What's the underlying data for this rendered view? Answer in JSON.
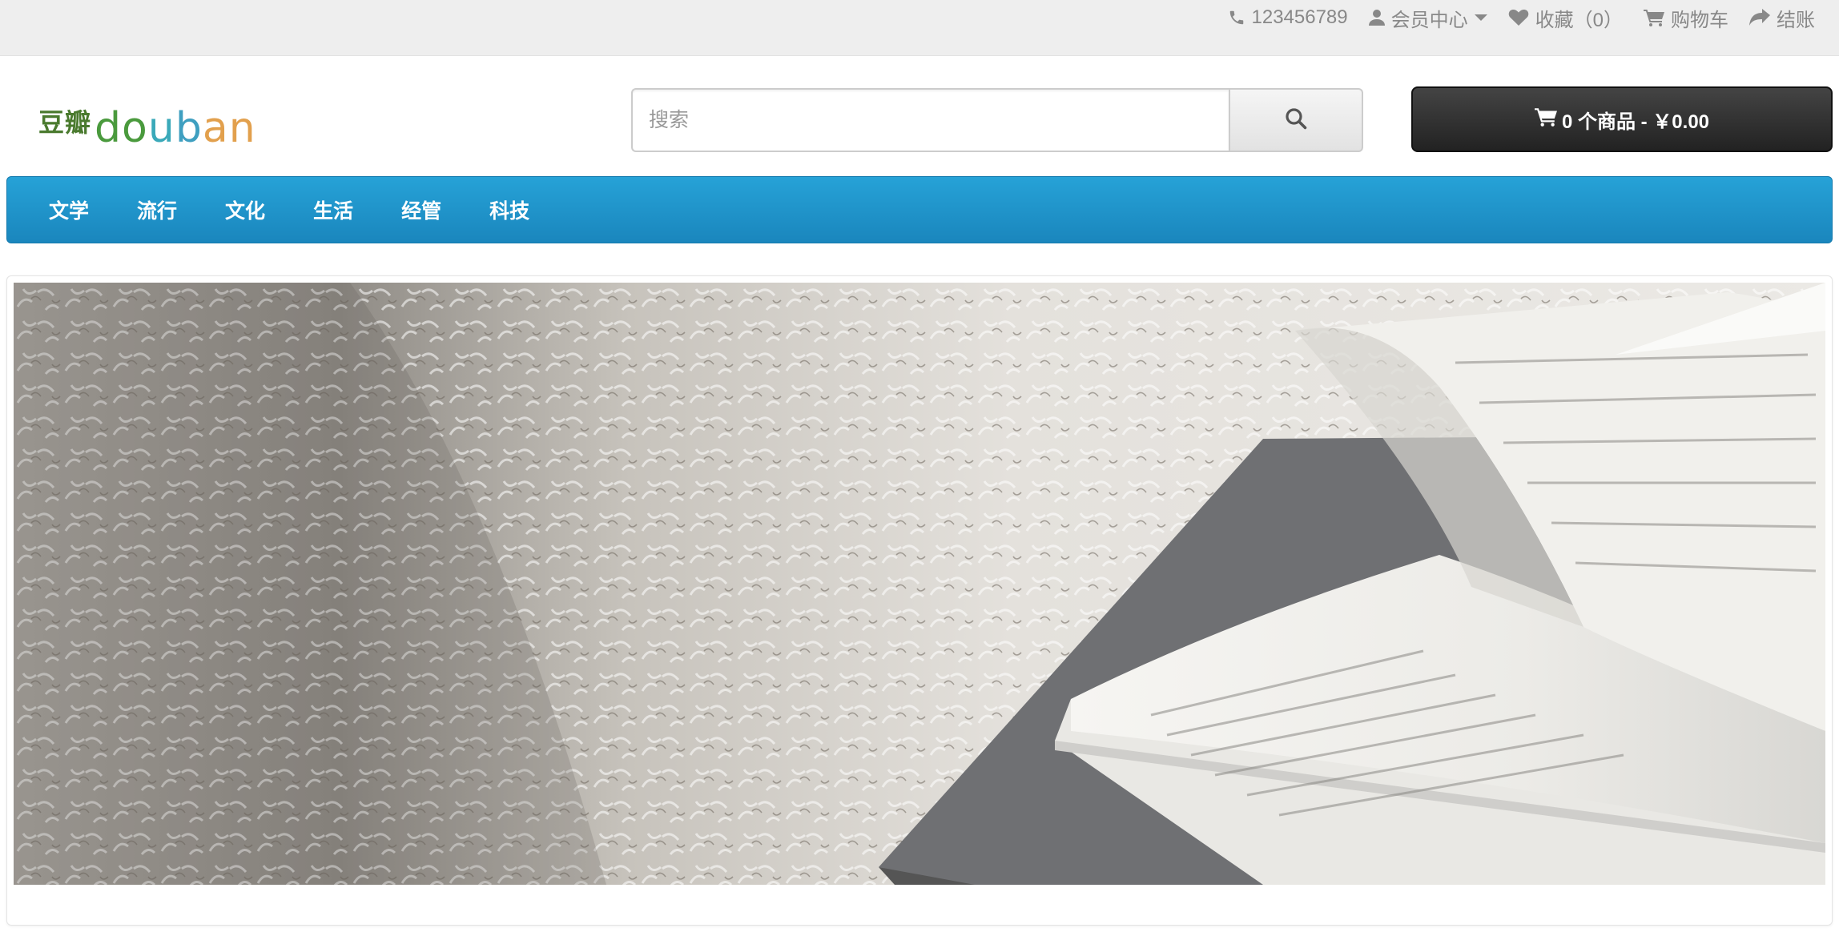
{
  "topbar": {
    "phone": "123456789",
    "member_center": "会员中心",
    "favorites": "收藏（0）",
    "cart": "购物车",
    "checkout": "结账",
    "icons": [
      "phone-icon",
      "user-icon",
      "caret-down-icon",
      "heart-icon",
      "cart-icon",
      "share-icon"
    ]
  },
  "header": {
    "logo_cn": "豆瓣",
    "logo_en": "douban",
    "logo_colors": [
      "#4a9a3d",
      "#3aa9b9",
      "#e2a04d"
    ],
    "search_placeholder": "搜索",
    "search_value": "",
    "cart_summary": "0 个商品 - ￥0.00"
  },
  "nav": {
    "items": [
      "文学",
      "流行",
      "文化",
      "生活",
      "经管",
      "科技"
    ]
  },
  "colors": {
    "nav_bg": "#1f96cc",
    "cart_bg": "#333333",
    "topbar_bg": "#eeeeee"
  }
}
